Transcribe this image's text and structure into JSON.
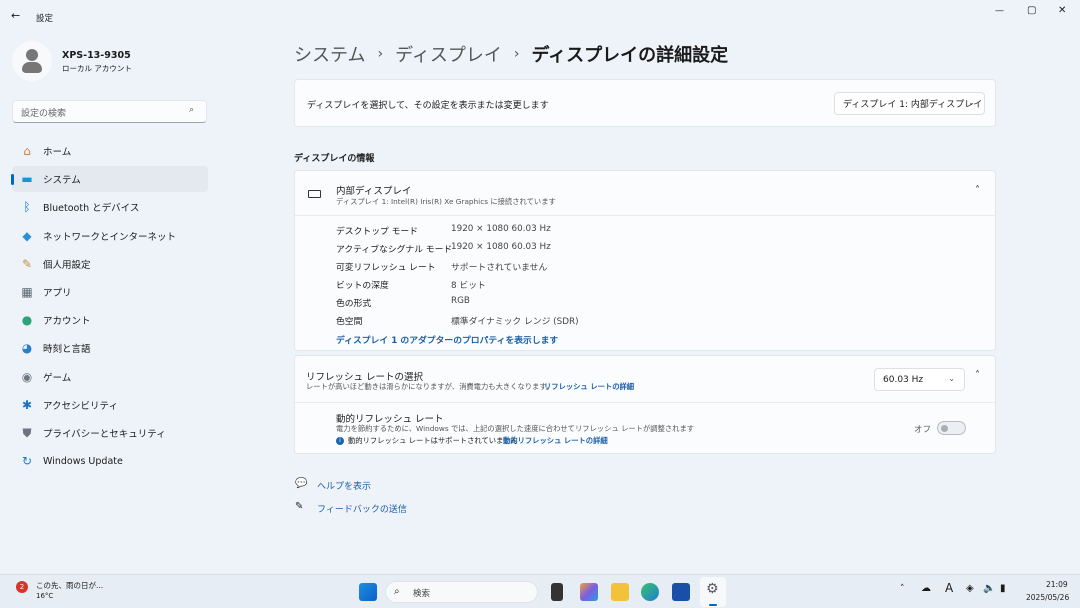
{
  "window": {
    "title": "設定",
    "back": "←",
    "minimize": "—",
    "maximize": "▢",
    "close": "✕"
  },
  "user": {
    "name": "XPS-13-9305",
    "account": "ローカル アカウント"
  },
  "search": {
    "placeholder": "設定の検索"
  },
  "sidebar": {
    "items": [
      {
        "label": "ホーム",
        "icon": "home-icon",
        "glyph": "⌂",
        "color": "#d9803a"
      },
      {
        "label": "システム",
        "icon": "system-icon",
        "glyph": "▬",
        "color": "#1b93d1",
        "selected": true
      },
      {
        "label": "Bluetooth とデバイス",
        "icon": "bluetooth-icon",
        "glyph": "ᛒ",
        "color": "#0a6fd6"
      },
      {
        "label": "ネットワークとインターネット",
        "icon": "wifi-icon",
        "glyph": "◆",
        "color": "#2a8fd6"
      },
      {
        "label": "個人用設定",
        "icon": "brush-icon",
        "glyph": "✎",
        "color": "#c98a3b"
      },
      {
        "label": "アプリ",
        "icon": "apps-icon",
        "glyph": "▦",
        "color": "#5a6470"
      },
      {
        "label": "アカウント",
        "icon": "account-icon",
        "glyph": "●",
        "color": "#2ea37a"
      },
      {
        "label": "時刻と言語",
        "icon": "globe-icon",
        "glyph": "◕",
        "color": "#2a7fc8"
      },
      {
        "label": "ゲーム",
        "icon": "gamepad-icon",
        "glyph": "◉",
        "color": "#6b7480"
      },
      {
        "label": "アクセシビリティ",
        "icon": "accessibility-icon",
        "glyph": "✱",
        "color": "#1a6fc0"
      },
      {
        "label": "プライバシーとセキュリティ",
        "icon": "shield-icon",
        "glyph": "⛊",
        "color": "#6b7480"
      },
      {
        "label": "Windows Update",
        "icon": "update-icon",
        "glyph": "↻",
        "color": "#1a7ad0"
      }
    ]
  },
  "breadcrumb": [
    "システム",
    "ディスプレイ",
    "ディスプレイの詳細設定"
  ],
  "breadcrumb_sep": "›",
  "select_display": {
    "label": "ディスプレイを選択して、その設定を表示または変更します",
    "value": "ディスプレイ 1: 内部ディスプレイ"
  },
  "info_section": {
    "heading": "ディスプレイの情報",
    "title": "内部ディスプレイ",
    "subtitle": "ディスプレイ 1: Intel(R) Iris(R) Xe Graphics に接続されています",
    "rows": [
      {
        "label": "デスクトップ モード",
        "value": "1920 × 1080 60.03 Hz"
      },
      {
        "label": "アクティブなシグナル モード",
        "value": "1920 × 1080 60.03 Hz"
      },
      {
        "label": "可変リフレッシュ レート",
        "value": "サポートされていません"
      },
      {
        "label": "ビットの深度",
        "value": "8 ビット"
      },
      {
        "label": "色の形式",
        "value": "RGB"
      },
      {
        "label": "色空間",
        "value": "標準ダイナミック レンジ (SDR)"
      }
    ],
    "adapter_link": "ディスプレイ 1 のアダプターのプロパティを表示します"
  },
  "refresh": {
    "title": "リフレッシュ レートの選択",
    "desc": "レートが高いほど動きは滑らかになりますが、消費電力も大きくなります。",
    "link": "リフレッシュ レートの詳細",
    "value": "60.03 Hz",
    "dynamic_title": "動的リフレッシュ レート",
    "dynamic_desc": "電力を節約するために、Windows では、上記の選択した速度に合わせてリフレッシュ レートが調整されます",
    "dynamic_note": "動的リフレッシュ レートはサポートされていません",
    "dynamic_link": "動的リフレッシュ レートの詳細",
    "toggle_label": "オフ",
    "toggle_on": false
  },
  "help": {
    "get_help": "ヘルプを表示",
    "feedback": "フィードバックの送信"
  },
  "taskbar": {
    "weather": "この先、雨の日が...",
    "temp": "16°C",
    "badge": "2",
    "search": "検索",
    "time": "21:09",
    "date": "2025/05/26"
  }
}
